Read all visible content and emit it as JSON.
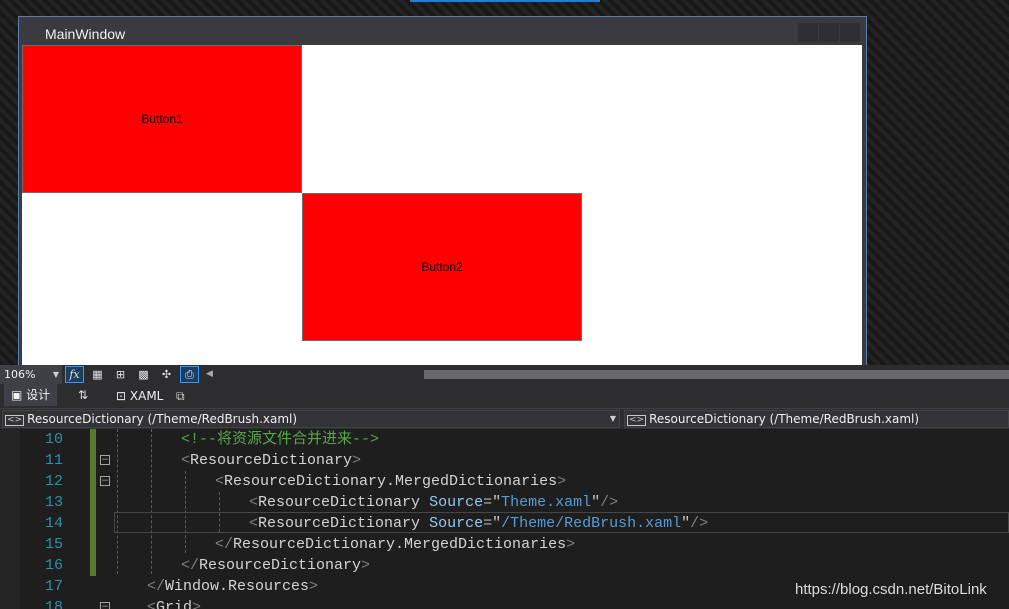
{
  "designer": {
    "window_title": "MainWindow",
    "button1_label": "Button1",
    "button2_label": "Button2",
    "button_color": "#ff0000"
  },
  "toolbar": {
    "zoom": "106%",
    "fx_label": "fx"
  },
  "tabs": {
    "design_label": "设计",
    "swap_glyph": "⇅",
    "xaml_label": "XAML"
  },
  "nav": {
    "left_text": "ResourceDictionary (/Theme/RedBrush.xaml)",
    "right_text": "ResourceDictionary (/Theme/RedBrush.xaml)"
  },
  "editor": {
    "line_numbers": [
      "10",
      "11",
      "12",
      "13",
      "14",
      "15",
      "16",
      "17",
      "18"
    ],
    "lines": {
      "l10": {
        "comment": "<!--将资源文件合并进来-->"
      },
      "l11": {
        "tag": "ResourceDictionary"
      },
      "l12": {
        "tag": "ResourceDictionary.MergedDictionaries"
      },
      "l13": {
        "tag": "ResourceDictionary",
        "attr": "Source",
        "value": "Theme.xaml"
      },
      "l14": {
        "tag": "ResourceDictionary",
        "attr": "Source",
        "value": "/Theme/RedBrush.xaml"
      },
      "l15": {
        "tag": "ResourceDictionary.MergedDictionaries"
      },
      "l16": {
        "tag": "ResourceDictionary"
      },
      "l17": {
        "tag": "Window.Resources"
      },
      "l18": {
        "tag": "Grid"
      }
    }
  },
  "watermark": "https://blog.csdn.net/BitoLink",
  "colors": {
    "comment": "#57a64a",
    "bracket": "#808080",
    "attribute": "#92caf4",
    "value": "#569cd6",
    "line_number": "#2b91af",
    "change_bar": "#577a2c"
  }
}
